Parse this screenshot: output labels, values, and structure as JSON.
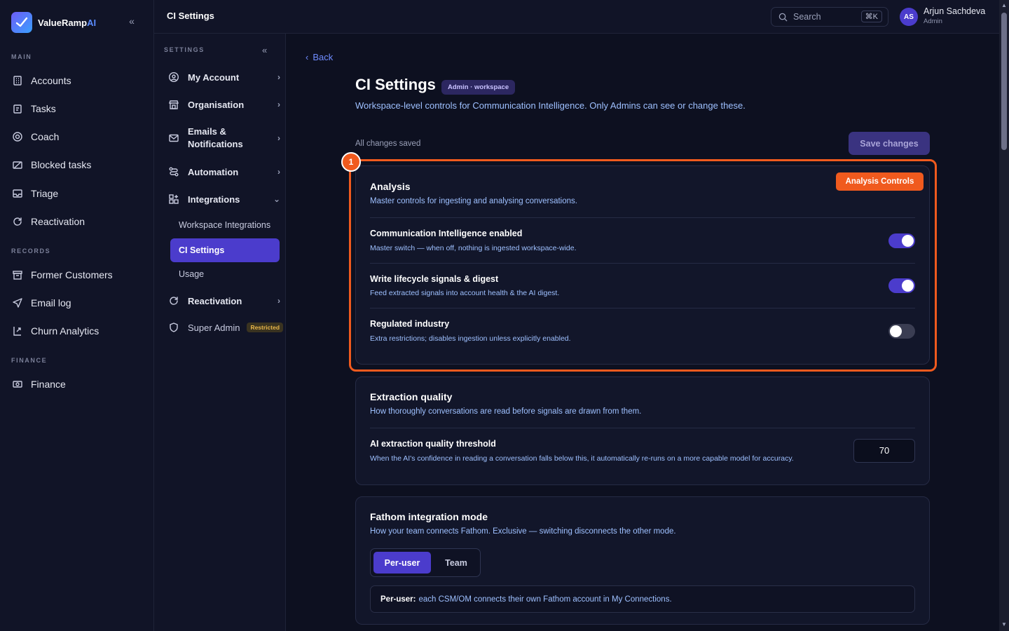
{
  "brand": {
    "name_main": "ValueRamp",
    "name_ai": "AI"
  },
  "sidebar": {
    "sections": [
      {
        "label": "MAIN",
        "items": [
          "Accounts",
          "Tasks",
          "Coach",
          "Blocked tasks",
          "Triage",
          "Reactivation"
        ]
      },
      {
        "label": "RECORDS",
        "items": [
          "Former Customers",
          "Email log",
          "Churn Analytics"
        ]
      },
      {
        "label": "FINANCE",
        "items": [
          "Finance"
        ]
      }
    ]
  },
  "settings_nav": {
    "title": "SETTINGS",
    "items": {
      "my_account": "My Account",
      "organisation": "Organisation",
      "emails_line1": "Emails &",
      "emails_line2": "Notifications",
      "automation": "Automation",
      "integrations": "Integrations",
      "reactivation": "Reactivation",
      "super_admin": "Super Admin",
      "restricted": "Restricted"
    },
    "integrations_children": [
      "Workspace Integrations",
      "CI Settings",
      "Usage"
    ]
  },
  "topbar": {
    "title": "CI Settings",
    "search_placeholder": "Search",
    "search_shortcut": "⌘K",
    "user_initials": "AS",
    "user_name": "Arjun Sachdeva",
    "user_role": "Admin"
  },
  "page": {
    "back": "Back",
    "title": "CI Settings",
    "scope_badge": "Admin · workspace",
    "subtitle": "Workspace-level controls for Communication Intelligence. Only Admins can see or change these.",
    "status": "All changes saved",
    "save_button": "Save changes"
  },
  "annotation": {
    "marker": "1",
    "label": "Analysis Controls"
  },
  "analysis": {
    "title": "Analysis",
    "subtitle": "Master controls for ingesting and analysing conversations.",
    "rows": [
      {
        "title": "Communication Intelligence enabled",
        "desc": "Master switch — when off, nothing is ingested workspace-wide.",
        "on": true
      },
      {
        "title": "Write lifecycle signals & digest",
        "desc": "Feed extracted signals into account health & the AI digest.",
        "on": true
      },
      {
        "title": "Regulated industry",
        "desc": "Extra restrictions; disables ingestion unless explicitly enabled.",
        "on": false
      }
    ]
  },
  "extraction": {
    "title": "Extraction quality",
    "subtitle": "How thoroughly conversations are read before signals are drawn from them.",
    "row_title": "AI extraction quality threshold",
    "row_desc": "When the AI's confidence in reading a conversation falls below this, it automatically re-runs on a more capable model for accuracy.",
    "value": "70"
  },
  "fathom": {
    "title": "Fathom integration mode",
    "subtitle": "How your team connects Fathom. Exclusive — switching disconnects the other mode.",
    "options": [
      "Per-user",
      "Team"
    ],
    "selected": "Per-user",
    "info_label": "Per-user:",
    "info_text": "each CSM/OM connects their own Fathom account in My Connections."
  },
  "colors": {
    "accent": "#4b3ccc",
    "highlight": "#f05a1e",
    "link": "#6f8cff"
  }
}
